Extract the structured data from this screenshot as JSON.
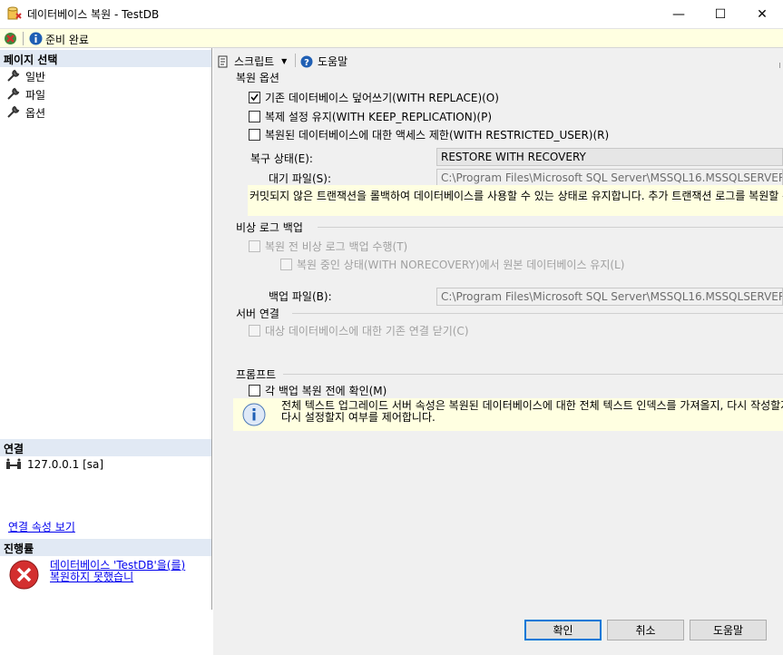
{
  "window": {
    "title": "데이터베이스 복원 - TestDB",
    "minimize": "—",
    "maximize": "☐",
    "close": "✕"
  },
  "statusbar": {
    "text": "준비 완료"
  },
  "left": {
    "select_page_header": "페이지 선택",
    "pages": [
      {
        "label": "일반"
      },
      {
        "label": "파일"
      },
      {
        "label": "옵션"
      }
    ],
    "connection_header": "연결",
    "server": "127.0.0.1 [sa]",
    "view_connection_props": "연결 속성 보기",
    "progress_header": "진행률",
    "progress_message": "데이터베이스 'TestDB'을(를) 복원하지 못했습니"
  },
  "toolbar": {
    "script_label": "스크립트",
    "help_label": "도움말"
  },
  "restore_options": {
    "group_label": "복원 옵션",
    "overwrite": "기존 데이터베이스 덮어쓰기(WITH REPLACE)(O)",
    "keep_replication": "복제 설정 유지(WITH KEEP_REPLICATION)(P)",
    "restricted_user": "복원된 데이터베이스에 대한 액세스 제한(WITH RESTRICTED_USER)(R)",
    "recovery_state_label": "복구 상태(E):",
    "recovery_state_value": "RESTORE WITH RECOVERY",
    "standby_file_label": "대기 파일(S):",
    "standby_file_value": "C:\\Program Files\\Microsoft SQL Server\\MSSQL16.MSSQLSERVER\\MSSQL\\Backup\\TestDB_RollbackUndo.bak",
    "recovery_info": "커밋되지 않은 트랜잭션을 롤백하여 데이터베이스를 사용할 수 있는 상태로 유지합니다. 추가 트랜잭션 로그를 복원할 수 없습니다."
  },
  "tail_log": {
    "group_label": "비상 로그 백업",
    "take_tail_log": "복원 전 비상 로그 백업 수행(T)",
    "norecovery": "복원 중인 상태(WITH NORECOVERY)에서 원본 데이터베이스 유지(L)",
    "backup_file_label": "백업 파일(B):",
    "backup_file_value": "C:\\Program Files\\Microsoft SQL Server\\MSSQL16.MSSQLSERVER\\MSSQL\\Backup\\TestDB_LogBackup.bak"
  },
  "server_connections": {
    "group_label": "서버 연결",
    "close_existing": "대상 데이터베이스에 대한 기존 연결 닫기(C)"
  },
  "prompt": {
    "group_label": "프롬프트",
    "confirm_each": "각 백업 복원 전에 확인(M)",
    "fulltext_info": "전체 텍스트 업그레이드 서버 속성은 복원된 데이터베이스에 대한 전체 텍스트 인덱스를 가져올지, 다시 작성할지 또는 다시 설정할지 여부를 제어합니다."
  },
  "buttons": {
    "ok": "확인",
    "cancel": "취소",
    "help": "도움말"
  },
  "colors": {
    "header_bg": "#e1e9f4",
    "info_bg": "#ffffe1",
    "error_red": "#d32f2f",
    "link_blue": "#0000ee"
  }
}
